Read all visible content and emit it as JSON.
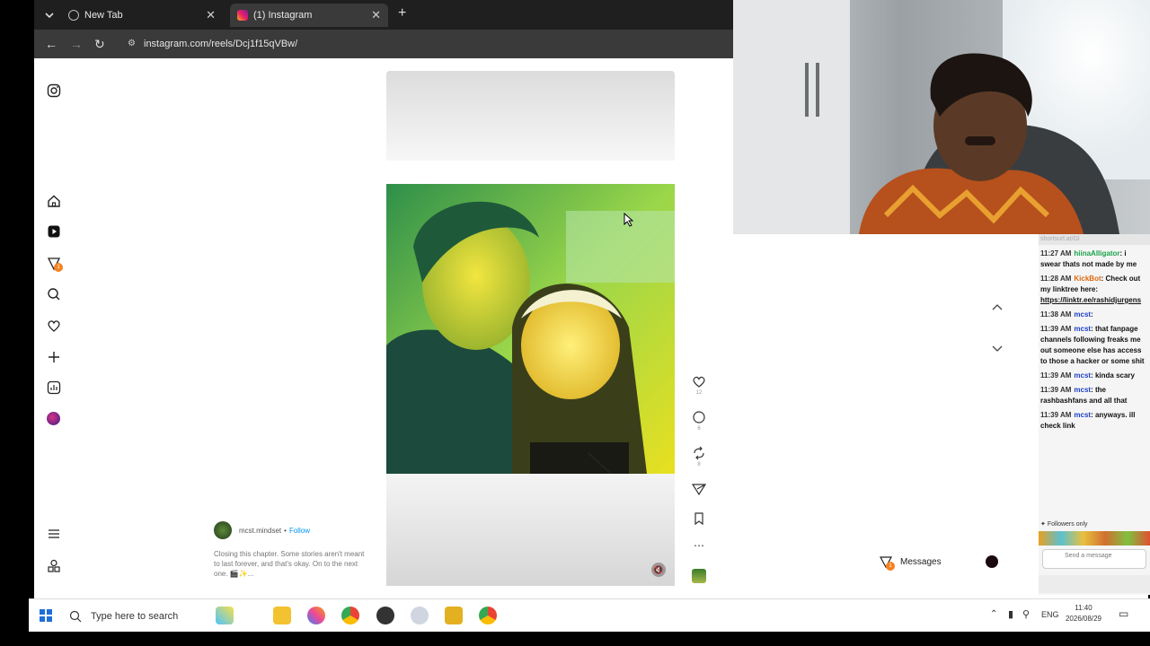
{
  "browser": {
    "tabs": [
      {
        "label": "New Tab"
      },
      {
        "label": "(1) Instagram"
      }
    ],
    "url": "instagram.com/reels/Dcj1f15qVBw/"
  },
  "reel": {
    "likes": "12",
    "comments": "6",
    "reposts": "8",
    "author": "mcst.mindset",
    "follow_label": "Follow",
    "caption": "Closing this chapter. Some stories aren't meant to last forever, and that's okay. On to the next one. 🎬✨..."
  },
  "messages": {
    "label": "Messages",
    "badge": "1"
  },
  "notification_badge": "1",
  "chat": {
    "top_text": "shortsurl.at/Gl",
    "messages": [
      {
        "time": "11:27 AM",
        "user": "hiinaAlligator",
        "user_color": "#1aa34a",
        "text": ": i swear thats not made by me"
      },
      {
        "time": "11:28 AM",
        "user": "KickBot",
        "user_color": "#e0670f",
        "text": ": Check out my linktree here:",
        "link": "https://linktr.ee/rashidjurgens"
      },
      {
        "time": "11:38 AM",
        "user": "mcst",
        "user_color": "#1e40c8",
        "text": ":"
      },
      {
        "time": "11:39 AM",
        "user": "mcst",
        "user_color": "#1e40c8",
        "text": ": that fanpage channels following freaks me out someone else has access to those a hacker or some shit"
      },
      {
        "time": "11:39 AM",
        "user": "mcst",
        "user_color": "#1e40c8",
        "text": ": kinda scary"
      },
      {
        "time": "11:39 AM",
        "user": "mcst",
        "user_color": "#1e40c8",
        "text": ": the rashbashfans and all that"
      },
      {
        "time": "11:39 AM",
        "user": "mcst",
        "user_color": "#1e40c8",
        "text": ": anyways. ill check link"
      }
    ],
    "followers_only": "Followers only",
    "send_placeholder": "Send a message"
  },
  "taskbar": {
    "search_placeholder": "Type here to search",
    "lang": "ENG",
    "time": "11:40",
    "date": "2026/08/29"
  },
  "colors": {
    "accent": "#0095f6",
    "badge": "#f5821f"
  }
}
